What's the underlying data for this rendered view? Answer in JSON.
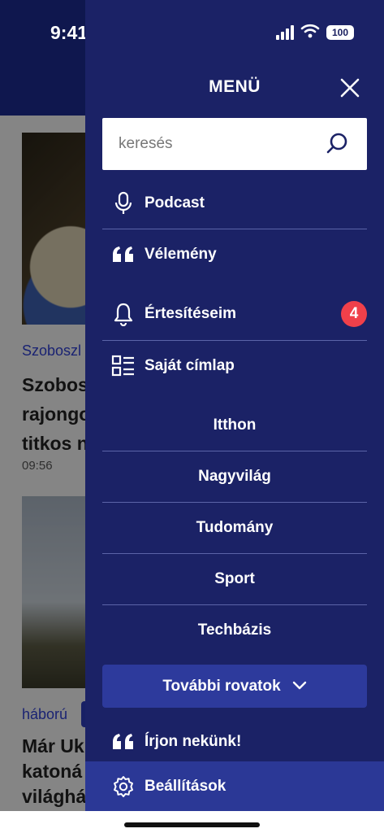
{
  "status_bar": {
    "time": "9:41",
    "battery": "100"
  },
  "background": {
    "article1": {
      "tag": "Szoboszl",
      "title": "Szobos rajongo titkos n",
      "time": "09:56"
    },
    "article2": {
      "tag": "háború",
      "title": "Már Uk katoná világhá"
    }
  },
  "menu": {
    "title": "MENÜ",
    "search": {
      "placeholder": "keresés"
    },
    "items": [
      {
        "label": "Podcast",
        "icon": "microphone-icon"
      },
      {
        "label": "Vélemény",
        "icon": "quote-icon"
      },
      {
        "label": "Értesítéseim",
        "icon": "bell-icon",
        "badge": "4"
      },
      {
        "label": "Saját címlap",
        "icon": "list-layout-icon"
      }
    ],
    "sections": [
      "Itthon",
      "Nagyvilág",
      "Tudomány",
      "Sport",
      "Techbázis"
    ],
    "more_sections": "További rovatok",
    "write_us": "Írjon nekünk!",
    "settings": "Beállítások"
  },
  "colors": {
    "drawer_bg": "#1b2266",
    "accent": "#2b3896",
    "badge": "#f0404a"
  }
}
